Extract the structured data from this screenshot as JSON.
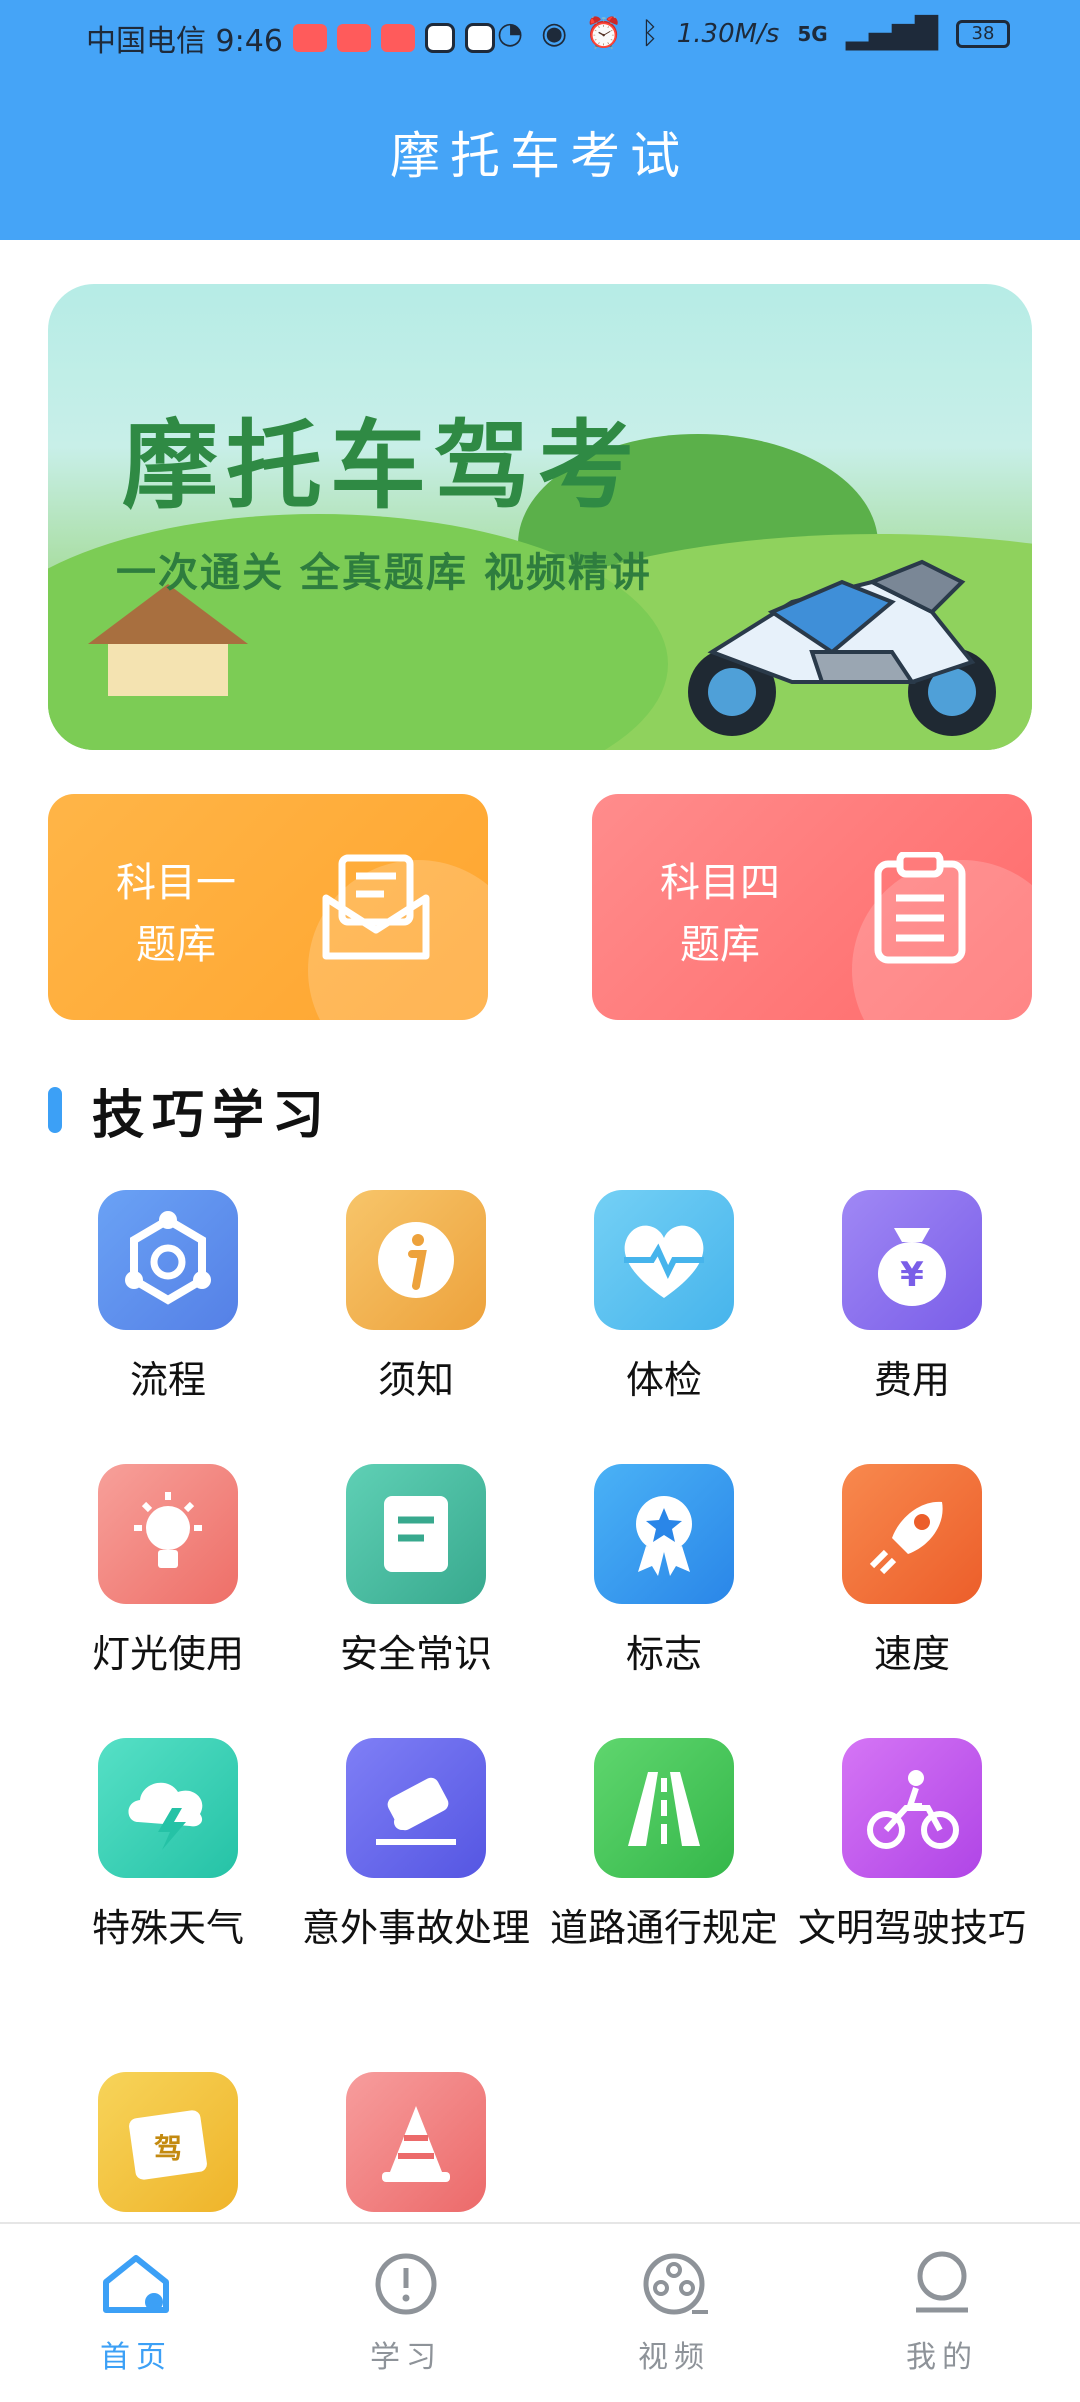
{
  "status_bar": {
    "carrier_time": "中国电信 9:46",
    "net_speed": "1.30M/s",
    "signal": "5G",
    "battery": "38"
  },
  "header": {
    "title": "摩托车考试"
  },
  "banner": {
    "title": "摩托车驾考",
    "subtitle": "一次通关 全真题库 视频精讲"
  },
  "cards": [
    {
      "label": "科目一题库",
      "icon": "envelope-doc-icon"
    },
    {
      "label": "科目四题库",
      "icon": "clipboard-icon"
    }
  ],
  "section": {
    "title": "技巧学习"
  },
  "skills": [
    {
      "label": "流程",
      "icon": "process-icon",
      "color": "#5f90ee"
    },
    {
      "label": "须知",
      "icon": "info-icon",
      "color": "#f2b050"
    },
    {
      "label": "体检",
      "icon": "heart-pulse-icon",
      "color": "#58c6f0"
    },
    {
      "label": "费用",
      "icon": "money-bag-icon",
      "color": "#8c6cf0"
    },
    {
      "label": "灯光使用",
      "icon": "bulb-icon",
      "color": "#f27f7a"
    },
    {
      "label": "安全常识",
      "icon": "note-icon",
      "color": "#4cc2a7"
    },
    {
      "label": "标志",
      "icon": "badge-icon",
      "color": "#3aa4f2"
    },
    {
      "label": "速度",
      "icon": "rocket-icon",
      "color": "#f2743c"
    },
    {
      "label": "特殊天气",
      "icon": "storm-icon",
      "color": "#38d2b8"
    },
    {
      "label": "意外事故处理",
      "icon": "accident-icon",
      "color": "#6b6cf0"
    },
    {
      "label": "道路通行规定",
      "icon": "road-icon",
      "color": "#4cc56c"
    },
    {
      "label": "文明驾驶技巧",
      "icon": "motorcycle-icon",
      "color": "#c457ee"
    },
    {
      "label": "",
      "icon": "license-icon",
      "color": "#f2c23c"
    },
    {
      "label": "",
      "icon": "cone-icon",
      "color": "#f27f7f"
    }
  ],
  "tabs": [
    {
      "label": "首页",
      "icon": "home-icon",
      "active": true
    },
    {
      "label": "学习",
      "icon": "alert-circle-icon",
      "active": false
    },
    {
      "label": "视频",
      "icon": "film-reel-icon",
      "active": false
    },
    {
      "label": "我的",
      "icon": "user-icon",
      "active": false
    }
  ]
}
